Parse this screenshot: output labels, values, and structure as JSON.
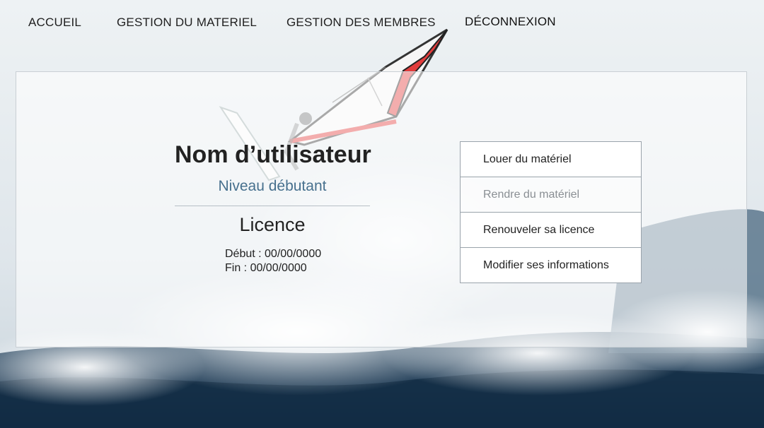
{
  "nav": {
    "items": [
      {
        "label": "ACCUEIL"
      },
      {
        "label": "GESTION DU MATERIEL"
      },
      {
        "label": "GESTION DES MEMBRES"
      },
      {
        "label": "DÉCONNEXION"
      }
    ]
  },
  "profile": {
    "username": "Nom d’utilisateur",
    "level": "Niveau débutant"
  },
  "licence": {
    "title": "Licence",
    "start": "Début : 00/00/0000",
    "end": "Fin : 00/00/0000"
  },
  "actions": [
    {
      "label": "Louer du matériel"
    },
    {
      "label": "Rendre du matériel"
    },
    {
      "label": "Renouveler sa licence"
    },
    {
      "label": "Modifier ses informations"
    }
  ],
  "colors": {
    "level_text": "#47708e",
    "sail_accent": "#e23c3c",
    "ocean_dark": "#1d3a52"
  }
}
